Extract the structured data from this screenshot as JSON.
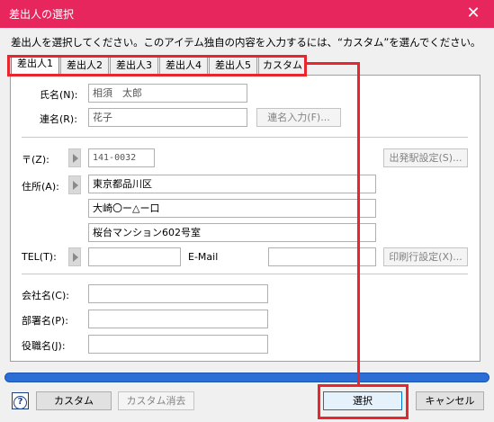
{
  "window": {
    "title": "差出人の選択",
    "close_glyph": "✕"
  },
  "instruction": "差出人を選択してください。このアイテム独自の内容を入力するには、“カスタム”を選んでください。",
  "tabs": [
    {
      "label": "差出人1",
      "active": true
    },
    {
      "label": "差出人2",
      "active": false
    },
    {
      "label": "差出人3",
      "active": false
    },
    {
      "label": "差出人4",
      "active": false
    },
    {
      "label": "差出人5",
      "active": false
    },
    {
      "label": "カスタム",
      "active": false
    }
  ],
  "form": {
    "name_label": "氏名(N):",
    "name_value": "相須　太郎",
    "joint_name_label": "連名(R):",
    "joint_name_value": "花子",
    "joint_name_button": "連名入力(F)...",
    "zip_label": "〒(Z):",
    "zip_value": "141-0032",
    "station_button": "出発駅設定(S)...",
    "address_label": "住所(A):",
    "address_lines": [
      "東京都品川区",
      "大崎〇ー△ー口",
      "桜台マンション602号室"
    ],
    "tel_label": "TEL(T):",
    "tel_value": "",
    "email_label": "E-Mail",
    "email_value": "",
    "print_button": "印刷行設定(X)...",
    "company_label": "会社名(C):",
    "company_value": "",
    "department_label": "部署名(P):",
    "department_value": "",
    "title_label": "役職名(J):",
    "title_value": ""
  },
  "footer": {
    "help_glyph": "?",
    "custom_button": "カスタム",
    "custom_clear_button": "カスタム消去",
    "select_button": "選択",
    "cancel_button": "キャンセル"
  },
  "colors": {
    "titlebar": "#e8265e",
    "highlight": "#e8262e",
    "progress": "#2b6fd6"
  }
}
